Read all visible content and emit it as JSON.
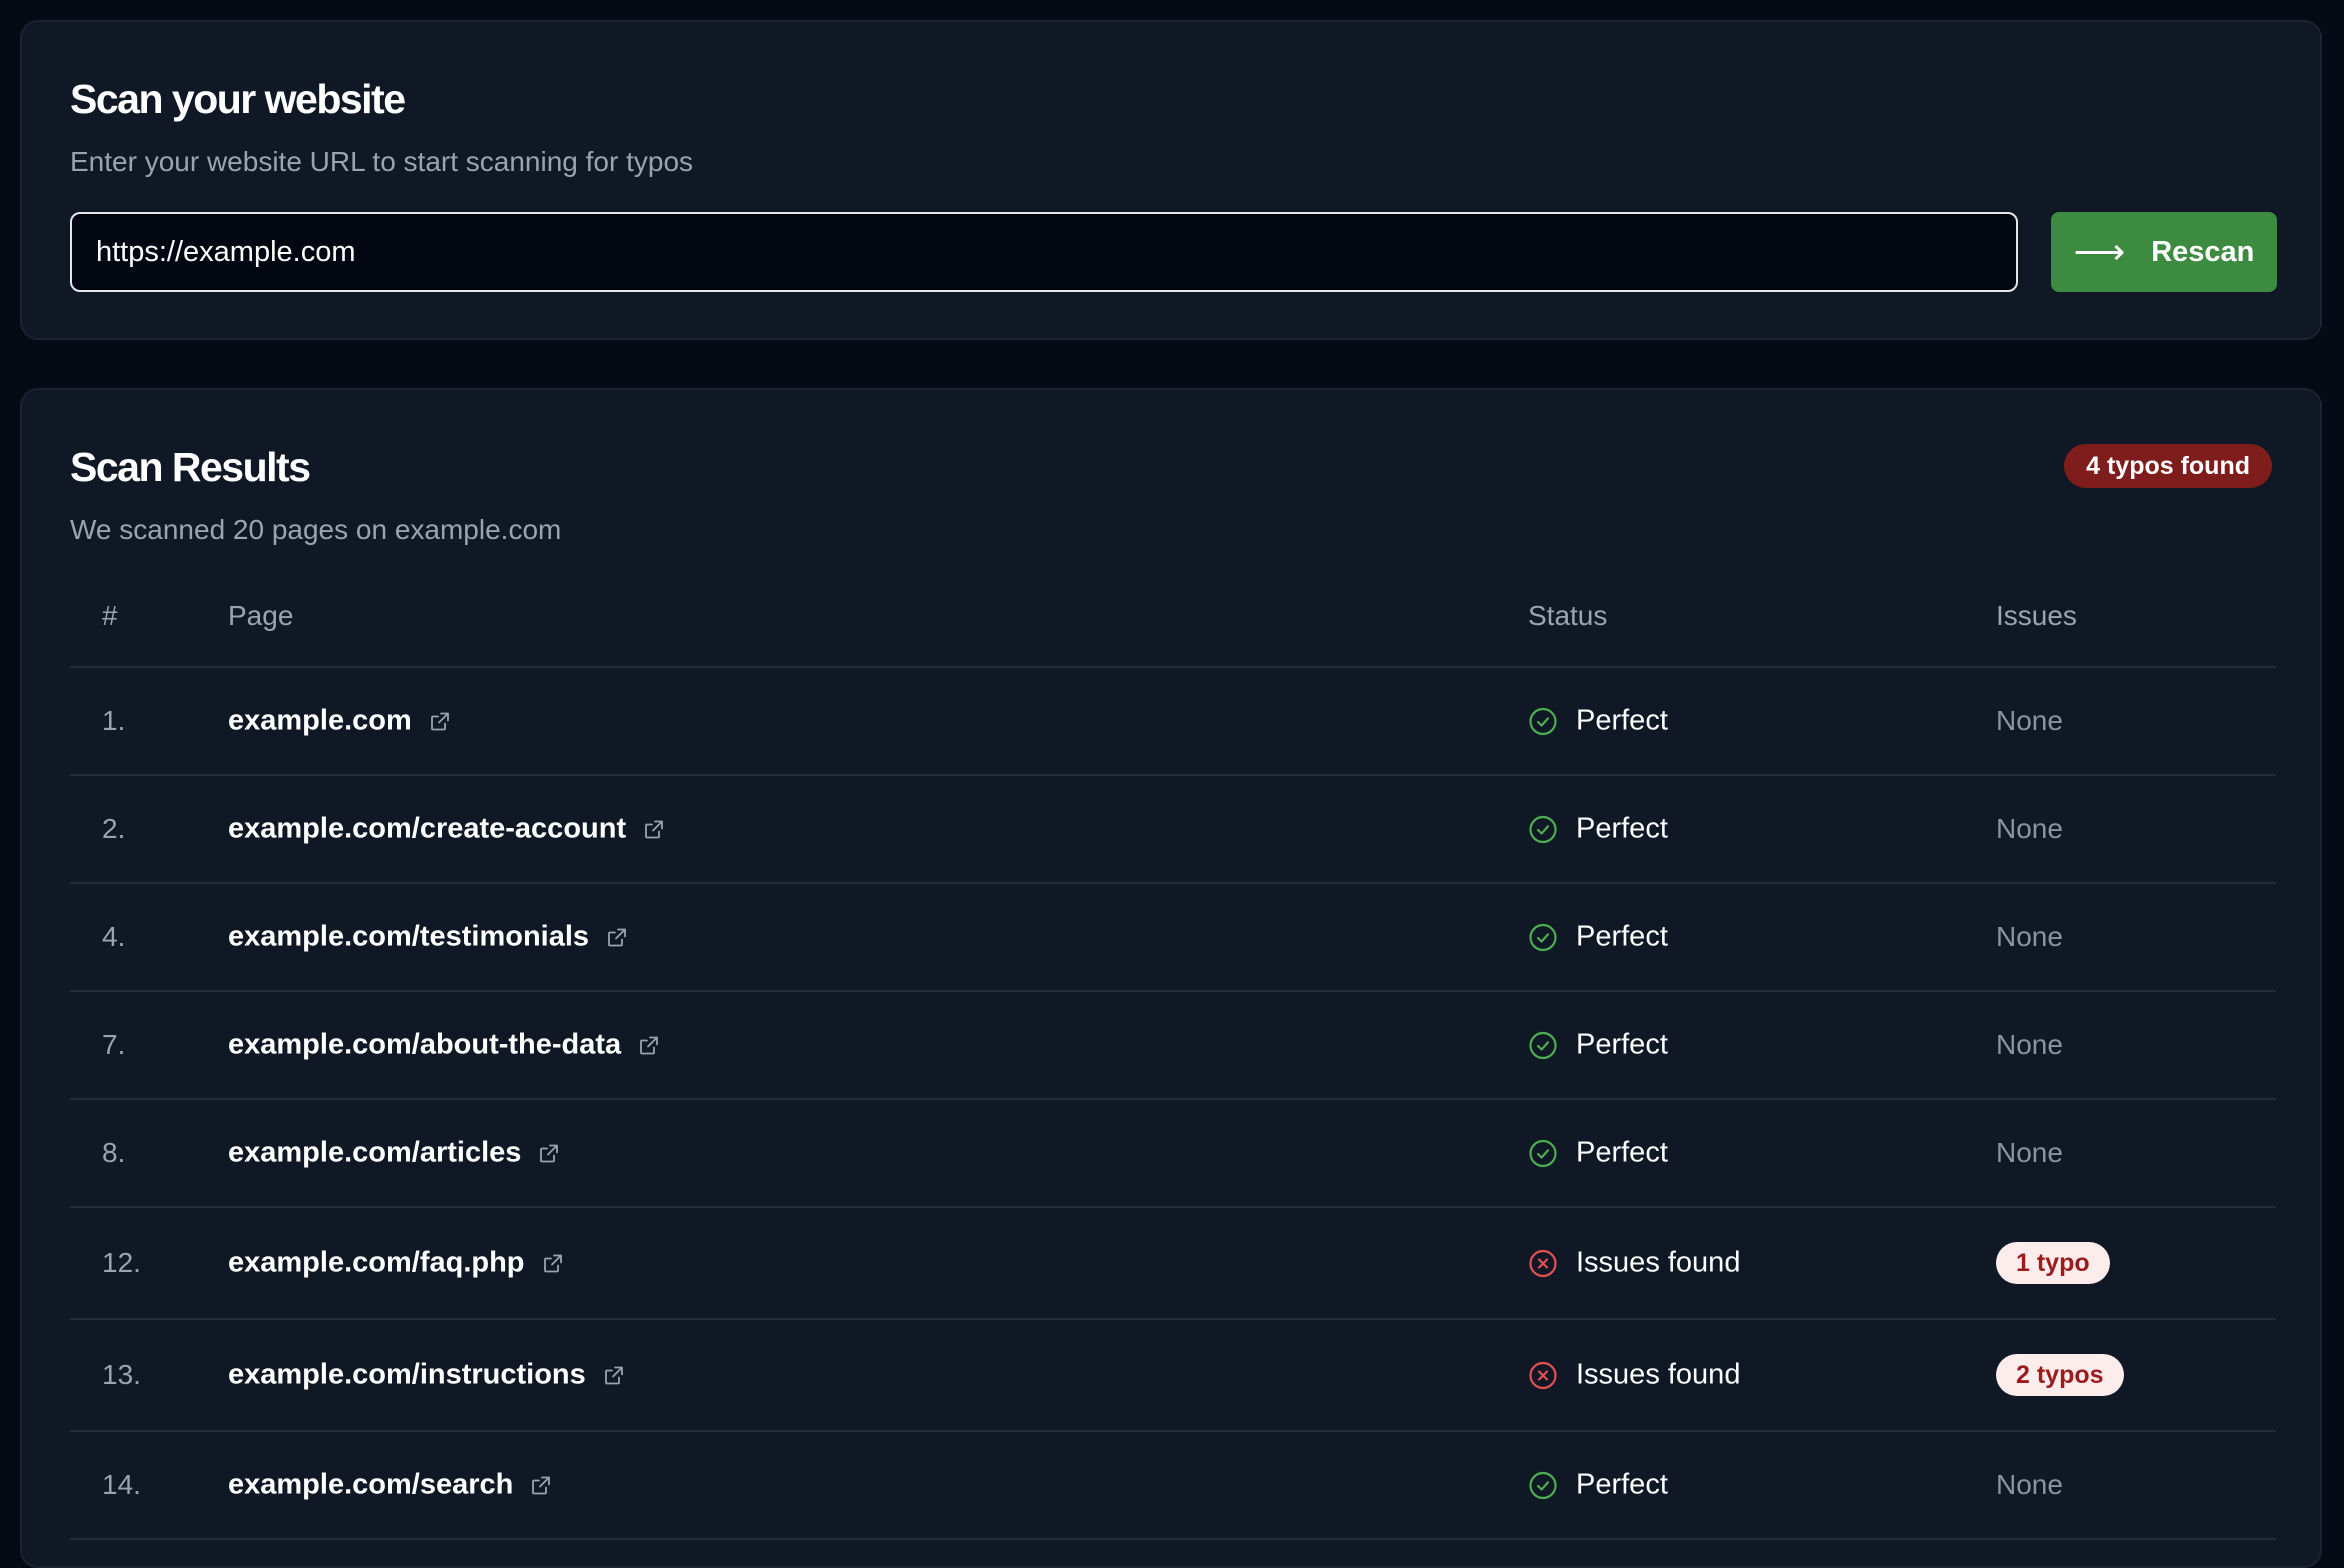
{
  "scan": {
    "title": "Scan your website",
    "subtitle": "Enter your website URL to start scanning for typos",
    "url_value": "https://example.com",
    "button_label": "Rescan",
    "button_color": "#3d8a41"
  },
  "results": {
    "title": "Scan Results",
    "subtitle": "We scanned 20 pages on example.com",
    "badge": "4 typos found",
    "columns": {
      "num": "#",
      "page": "Page",
      "status": "Status",
      "issues": "Issues"
    },
    "rows": [
      {
        "num": "1.",
        "page": "example.com",
        "status": "Perfect",
        "state": "ok",
        "issues": "None"
      },
      {
        "num": "2.",
        "page": "example.com/create-account",
        "status": "Perfect",
        "state": "ok",
        "issues": "None"
      },
      {
        "num": "4.",
        "page": "example.com/testimonials",
        "status": "Perfect",
        "state": "ok",
        "issues": "None"
      },
      {
        "num": "7.",
        "page": "example.com/about-the-data",
        "status": "Perfect",
        "state": "ok",
        "issues": "None"
      },
      {
        "num": "8.",
        "page": "example.com/articles",
        "status": "Perfect",
        "state": "ok",
        "issues": "None"
      },
      {
        "num": "12.",
        "page": "example.com/faq.php",
        "status": "Issues found",
        "state": "error",
        "issues": "1 typo"
      },
      {
        "num": "13.",
        "page": "example.com/instructions",
        "status": "Issues found",
        "state": "error",
        "issues": "2 typos"
      },
      {
        "num": "14.",
        "page": "example.com/search",
        "status": "Perfect",
        "state": "ok",
        "issues": "None"
      }
    ]
  },
  "colors": {
    "ok": "#4caf50",
    "error": "#e05252",
    "badge": "#7f1d1d"
  },
  "icons": {
    "ok": "check-circle-icon",
    "error": "x-circle-icon",
    "external": "external-link-icon",
    "arrow": "arrow-right-icon"
  }
}
